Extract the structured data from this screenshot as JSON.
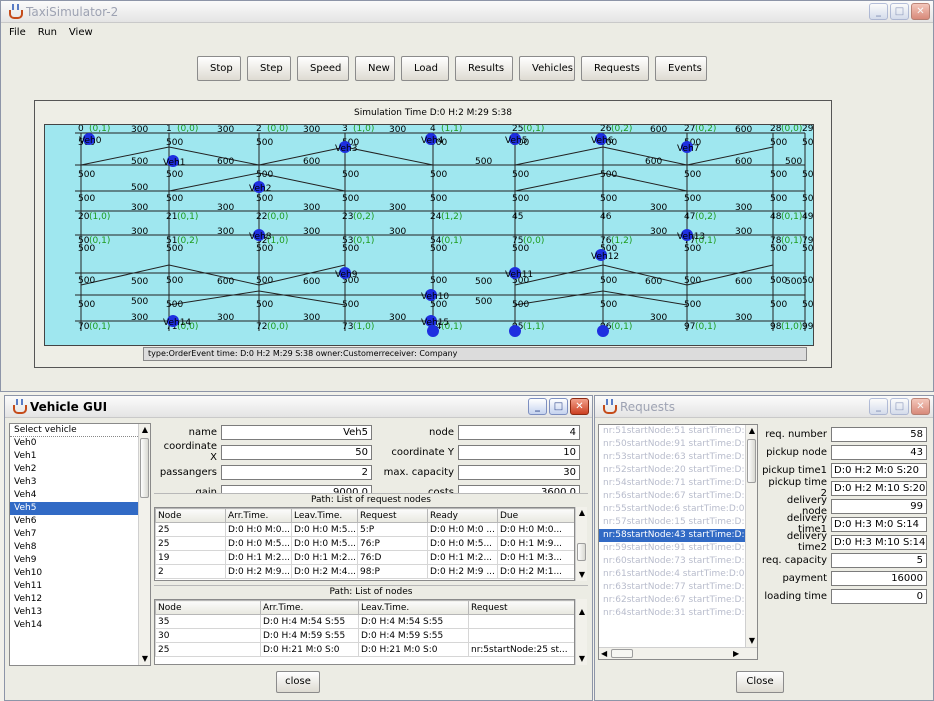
{
  "main_window": {
    "title": "TaxiSimulator-2",
    "menu": [
      "File",
      "Run",
      "View"
    ],
    "toolbar": [
      "Stop",
      "Step",
      "Speed",
      "New",
      "Load",
      "Results",
      "Vehicles",
      "Requests",
      "Events"
    ],
    "simulation_time": "Simulation Time D:0 H:2 M:29 S:38",
    "event_label": "type:OrderEvent time: D:0 H:2 M:29 S:38 owner:Customerreceiver: Company"
  },
  "graph": {
    "top_row": [
      {
        "id": "0",
        "tag": "(0,1)"
      },
      {
        "id": "1",
        "tag": "(0,0)"
      },
      {
        "id": "2",
        "tag": "(0,0)"
      },
      {
        "id": "3",
        "tag": "(1,0)"
      },
      {
        "id": "4",
        "tag": "(1,1)"
      },
      {
        "id": "25",
        "tag": "(0,1)"
      },
      {
        "id": "26",
        "tag": "(0,2)"
      },
      {
        "id": "27",
        "tag": "(0,2)"
      },
      {
        "id": "28",
        "tag": "(0,0)"
      },
      {
        "id": "29",
        "tag": "(0,0)"
      }
    ],
    "bottom_row": [
      {
        "id": "70",
        "tag": "(0,1)"
      },
      {
        "id": "71",
        "tag": "(0,0)"
      },
      {
        "id": "72",
        "tag": "(0,0)"
      },
      {
        "id": "73",
        "tag": "(1,0)"
      },
      {
        "id": "74",
        "tag": "(0,1)"
      },
      {
        "id": "95",
        "tag": "(1,1)"
      },
      {
        "id": "96",
        "tag": "(0,1)"
      },
      {
        "id": "97",
        "tag": "(0,1)"
      },
      {
        "id": "98",
        "tag": "(1,0)"
      },
      {
        "id": "99",
        "tag": "(0,1)"
      }
    ],
    "mid_row_a": [
      {
        "id": "20",
        "tag": "(1,0)"
      },
      {
        "id": "21",
        "tag": "(0,1)"
      },
      {
        "id": "22",
        "tag": "(0,0)"
      },
      {
        "id": "23",
        "tag": "(0,2)"
      },
      {
        "id": "24",
        "tag": "(1,2)"
      },
      {
        "id": "45",
        "tag": ""
      },
      {
        "id": "46",
        "tag": ""
      },
      {
        "id": "47",
        "tag": "(0,2)"
      },
      {
        "id": "48",
        "tag": "(0,1)"
      },
      {
        "id": "49",
        "tag": "(1,0)"
      }
    ],
    "mid_row_b": [
      {
        "id": "50",
        "tag": "(0,1)"
      },
      {
        "id": "51",
        "tag": "(0,2)"
      },
      {
        "id": "52",
        "tag": "(1,0)"
      },
      {
        "id": "53",
        "tag": "(0,1)"
      },
      {
        "id": "54",
        "tag": "(0,1)"
      },
      {
        "id": "75",
        "tag": "(0,0)"
      },
      {
        "id": "76",
        "tag": "(1,2)"
      },
      {
        "id": "77",
        "tag": "(0,1)"
      },
      {
        "id": "78",
        "tag": "(0,1)"
      },
      {
        "id": "79",
        "tag": "(0,1)"
      }
    ],
    "edge_labels": {
      "h_long": "600",
      "h_short": "300",
      "v": "500",
      "h_mid": "500",
      "h_mid2": "400",
      "h_link": "500"
    },
    "vehicle_labels": [
      "Veh0",
      "Veh1",
      "Veh2",
      "Veh3",
      "Veh4",
      "Veh5",
      "Veh6",
      "Veh7",
      "Veh8",
      "Veh9",
      "Veh10",
      "Veh11",
      "Veh12",
      "Veh13",
      "Veh14",
      "Veh15"
    ]
  },
  "vehicle_gui": {
    "title": "Vehicle GUI",
    "select_label": "Select vehicle",
    "vehicles": [
      "Veh0",
      "Veh1",
      "Veh2",
      "Veh3",
      "Veh4",
      "Veh5",
      "Veh6",
      "Veh7",
      "Veh8",
      "Veh9",
      "Veh10",
      "Veh11",
      "Veh12",
      "Veh13",
      "Veh14"
    ],
    "selected_index": 5,
    "fields": {
      "name_label": "name",
      "name": "Veh5",
      "node_label": "node",
      "node": "4",
      "cx_label": "coordinate X",
      "cx": "50",
      "cy_label": "coordinate Y",
      "cy": "10",
      "pass_label": "passangers",
      "passengers": "2",
      "cap_label": "max. capacity",
      "capacity": "30",
      "gain_label": "gain",
      "gain": "9000.0",
      "costs_label": "costs",
      "costs": "3600.0"
    },
    "path_requests": {
      "title": "Path: List of request nodes",
      "columns": [
        "Node",
        "Arr.Time.",
        "Leav.Time.",
        "Request",
        "Ready",
        "Due"
      ],
      "rows": [
        [
          "25",
          "D:0 H:0 M:0...",
          "D:0 H:0 M:5...",
          "5:P",
          "D:0 H:0 M:0 ...",
          "D:0 H:0 M:0..."
        ],
        [
          "25",
          "D:0 H:0 M:5...",
          "D:0 H:0 M:5...",
          "76:P",
          "D:0 H:0 M:5...",
          "D:0 H:1 M:9..."
        ],
        [
          "19",
          "D:0 H:1 M:2...",
          "D:0 H:1 M:2...",
          "76:D",
          "D:0 H:1 M:2...",
          "D:0 H:1 M:3..."
        ],
        [
          "2",
          "D:0 H:2 M:9...",
          "D:0 H:2 M:4...",
          "98:P",
          "D:0 H:2 M:9 ...",
          "D:0 H:2 M:1..."
        ]
      ]
    },
    "path_nodes": {
      "title": "Path: List of nodes",
      "columns": [
        "Node",
        "Arr.Time.",
        "Leav.Time.",
        "Request"
      ],
      "rows": [
        [
          "35",
          "D:0 H:4 M:54 S:55",
          "D:0 H:4 M:54 S:55",
          ""
        ],
        [
          "30",
          "D:0 H:4 M:59 S:55",
          "D:0 H:4 M:59 S:55",
          ""
        ],
        [
          "25",
          "D:0 H:21 M:0 S:0",
          "D:0 H:21 M:0 S:0",
          "nr:5startNode:25 st..."
        ]
      ]
    },
    "close_label": "close"
  },
  "requests": {
    "title": "Requests",
    "list": [
      "nr:51startNode:51 startTime:D:",
      "nr:50startNode:91 startTime:D:",
      "nr:53startNode:63 startTime:D:",
      "nr:52startNode:20 startTime:D:",
      "nr:54startNode:71 startTime:D:",
      "nr:56startNode:67 startTime:D:",
      "nr:55startNode:6 startTime:D:0",
      "nr:57startNode:15 startTime:D:",
      "nr:58startNode:43 startTime:D:",
      "nr:59startNode:91 startTime:D:",
      "nr:60startNode:73 startTime:D:",
      "nr:61startNode:4 startTime:D:0",
      "nr:63startNode:77 startTime:D:",
      "nr:62startNode:67 startTime:D:",
      "nr:64startNode:31 startTime:D:"
    ],
    "selected_index": 8,
    "fields": [
      {
        "label": "req. number",
        "value": "58",
        "align": "right"
      },
      {
        "label": "pickup node",
        "value": "43",
        "align": "right"
      },
      {
        "label": "pickup time1",
        "value": "D:0 H:2 M:0 S:20",
        "align": "left"
      },
      {
        "label": "pickup time 2",
        "value": "D:0 H:2 M:10 S:20",
        "align": "left"
      },
      {
        "label": "delivery node",
        "value": "99",
        "align": "right"
      },
      {
        "label": "delivery time1",
        "value": "D:0 H:3 M:0 S:14",
        "align": "left"
      },
      {
        "label": "delivery time2",
        "value": "D:0 H:3 M:10 S:14",
        "align": "left"
      },
      {
        "label": "req. capacity",
        "value": "5",
        "align": "right"
      },
      {
        "label": "payment",
        "value": "16000",
        "align": "right"
      },
      {
        "label": "loading time",
        "value": "0",
        "align": "right"
      }
    ],
    "close_label": "Close"
  }
}
